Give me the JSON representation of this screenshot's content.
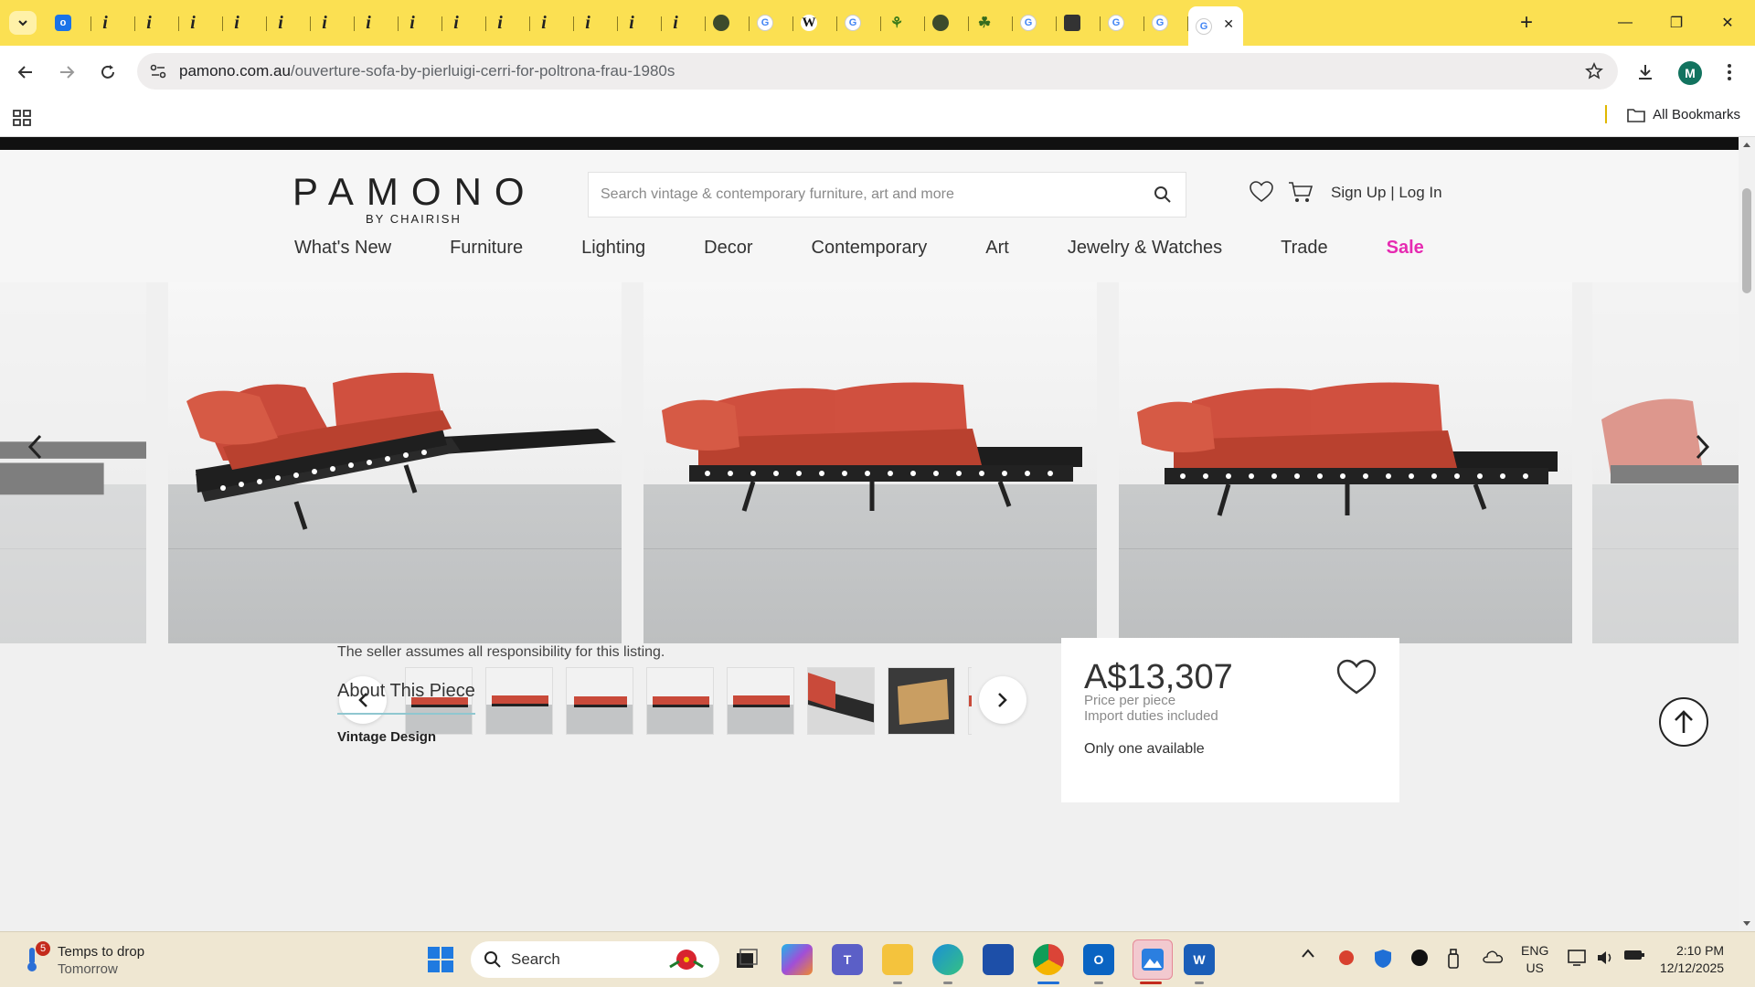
{
  "browser": {
    "url_domain": "pamono.com.au",
    "url_path": "/ouverture-sofa-by-pierluigi-cerri-for-poltrona-frau-1980s",
    "bookmarks_all": "All Bookmarks",
    "profile_initial": "M",
    "tab_favicons": [
      "outlook",
      "i",
      "i",
      "i",
      "i",
      "i",
      "i",
      "i",
      "i",
      "i",
      "i",
      "i",
      "i",
      "i",
      "i",
      "dark-circle",
      "google",
      "wikipedia",
      "google",
      "palm",
      "dark-circle",
      "leaf",
      "google",
      "cube",
      "google",
      "google",
      "active"
    ]
  },
  "site": {
    "logo": "PAMONO",
    "logo_sub": "BY CHAIRISH",
    "search_placeholder": "Search vintage & contemporary furniture, art and more",
    "auth_text": "Sign Up | Log In",
    "nav": [
      "What's New",
      "Furniture",
      "Lighting",
      "Decor",
      "Contemporary",
      "Art",
      "Jewelry & Watches",
      "Trade",
      "Sale"
    ],
    "accent_sale": "#e62ab1"
  },
  "product": {
    "seller_note": "The seller assumes all responsibility for this listing.",
    "about_tab": "About This Piece",
    "section_heading": "Vintage Design",
    "price": "A$13,307",
    "price_per": "Price per piece",
    "duties": "Import duties included",
    "availability": "Only one available"
  },
  "taskbar": {
    "weather_badge": "5",
    "weather_title": "Temps to drop",
    "weather_sub": "Tomorrow",
    "search_label": "Search",
    "lang_1": "ENG",
    "lang_2": "US",
    "time": "2:10 PM",
    "date": "12/12/2025"
  }
}
